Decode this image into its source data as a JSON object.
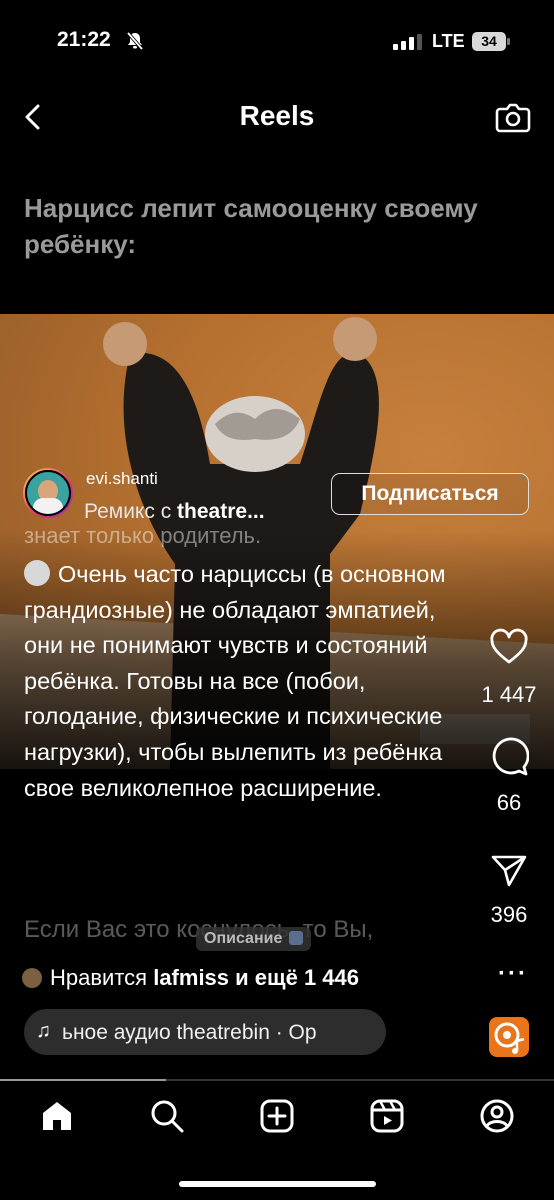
{
  "status": {
    "time": "21:22",
    "network": "LTE",
    "battery": "34"
  },
  "header": {
    "title": "Reels"
  },
  "reel": {
    "headline": "Нарцисс лепит самооценку своему ребёнку:"
  },
  "author": {
    "username": "evi.shanti",
    "remix_prefix": "Ремикс с",
    "remix_source": "theatre...",
    "follow_label": "Подписаться"
  },
  "caption": {
    "top_line": "знает только родитель.",
    "body": "Очень часто нарциссы (в основном грандиозные) не обладают эмпатией, они не понимают чувств и состояний ребёнка. Готовы на все (побои, голодание, физические и психические нагрузки), чтобы вылепить из ребёнка свое великолепное расширение.",
    "more_line": "Если Вас это коснулось, то Вы,",
    "description_label": "Описание"
  },
  "actions": {
    "likes": "1 447",
    "comments": "66",
    "shares": "396",
    "more": "···"
  },
  "likes_row": {
    "prefix": "Нравится",
    "user": "lafmiss",
    "suffix": "и ещё 1 446"
  },
  "audio": {
    "text": "ьное аудио   theatrebin · Ор"
  },
  "progress": 0.3,
  "nav": {
    "items": [
      "home-icon",
      "search-icon",
      "create-icon",
      "reels-icon",
      "profile-icon"
    ]
  }
}
